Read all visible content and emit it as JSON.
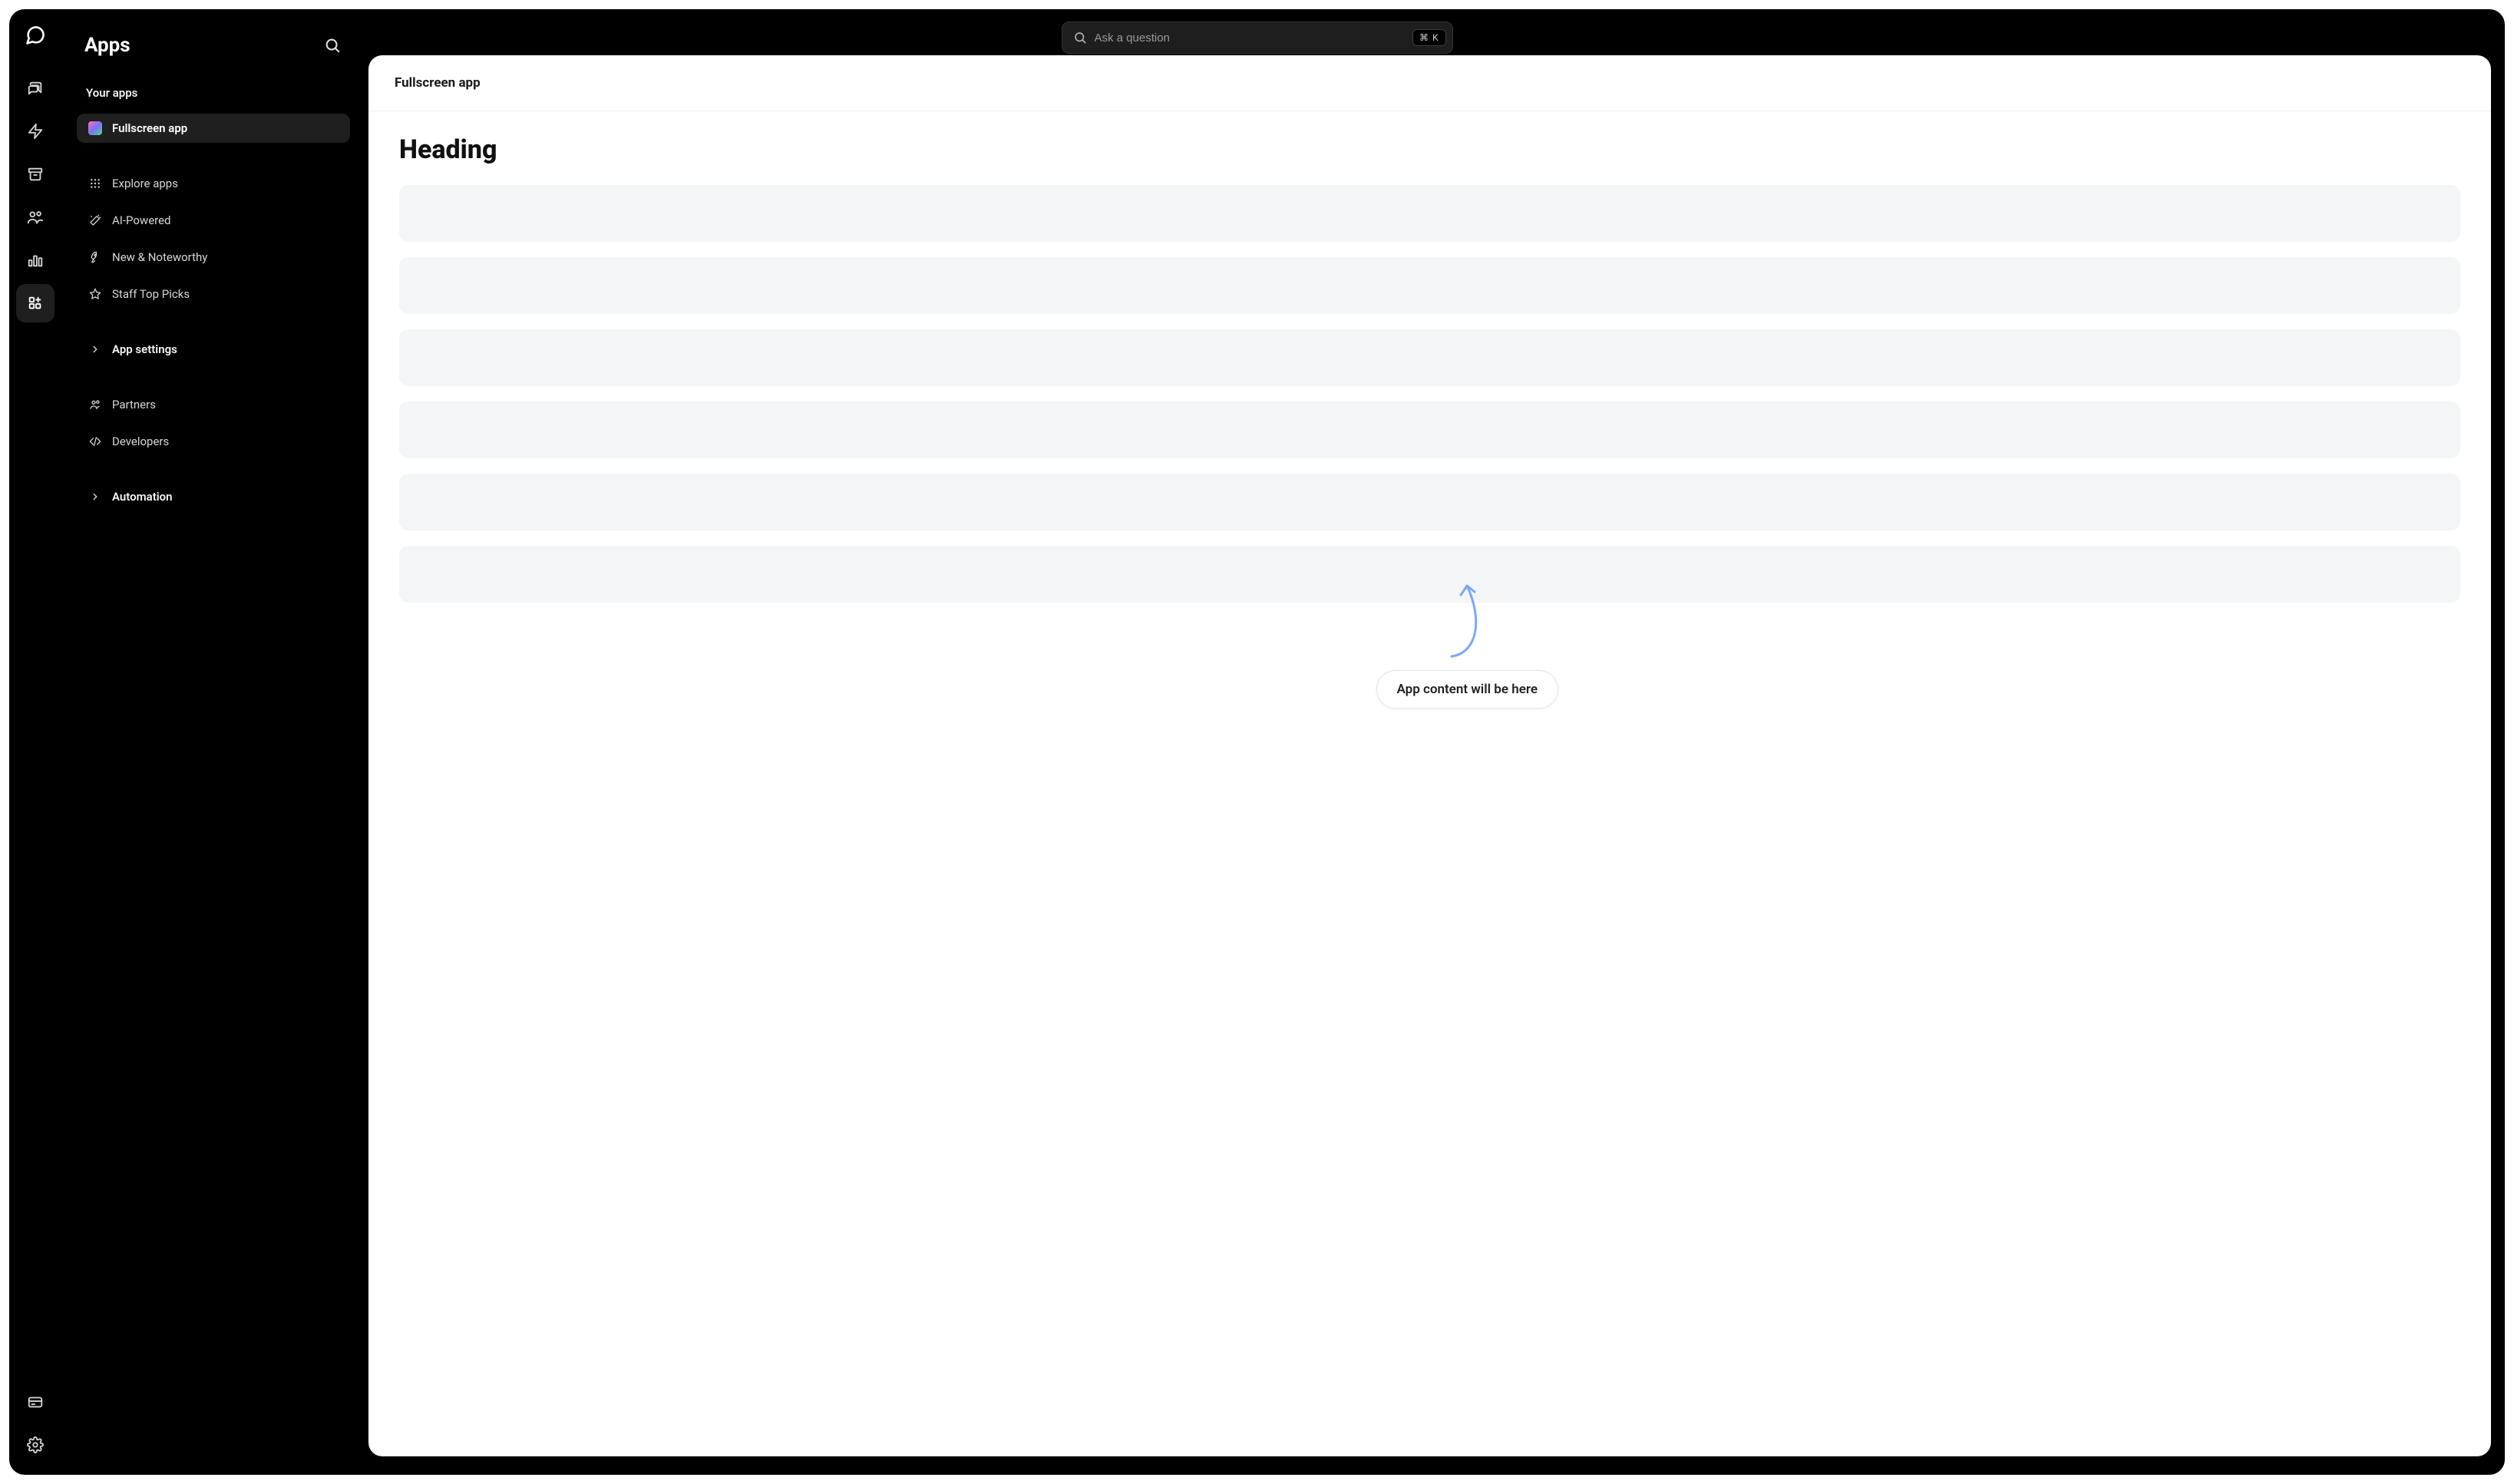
{
  "search": {
    "placeholder": "Ask a question",
    "shortcut": "⌘ K"
  },
  "rail": {
    "items": [
      {
        "name": "chat",
        "active": false
      },
      {
        "name": "bolt",
        "active": false
      },
      {
        "name": "archive",
        "active": false
      },
      {
        "name": "people",
        "active": false
      },
      {
        "name": "analytics",
        "active": false
      },
      {
        "name": "apps",
        "active": true
      }
    ],
    "bottom": [
      {
        "name": "billing"
      },
      {
        "name": "settings"
      }
    ]
  },
  "sidebar": {
    "title": "Apps",
    "your_apps_label": "Your apps",
    "your_apps": [
      {
        "label": "Fullscreen app",
        "selected": true
      }
    ],
    "discover": [
      {
        "label": "Explore apps",
        "icon": "grid"
      },
      {
        "label": "AI-Powered",
        "icon": "wand"
      },
      {
        "label": "New & Noteworthy",
        "icon": "rocket"
      },
      {
        "label": "Staff Top Picks",
        "icon": "star"
      }
    ],
    "app_settings_label": "App settings",
    "links": [
      {
        "label": "Partners",
        "icon": "people"
      },
      {
        "label": "Developers",
        "icon": "code"
      }
    ],
    "automation_label": "Automation"
  },
  "main": {
    "crumb": "Fullscreen app",
    "heading": "Heading",
    "skeleton_count": 6,
    "annotation_text": "App content will be here"
  }
}
